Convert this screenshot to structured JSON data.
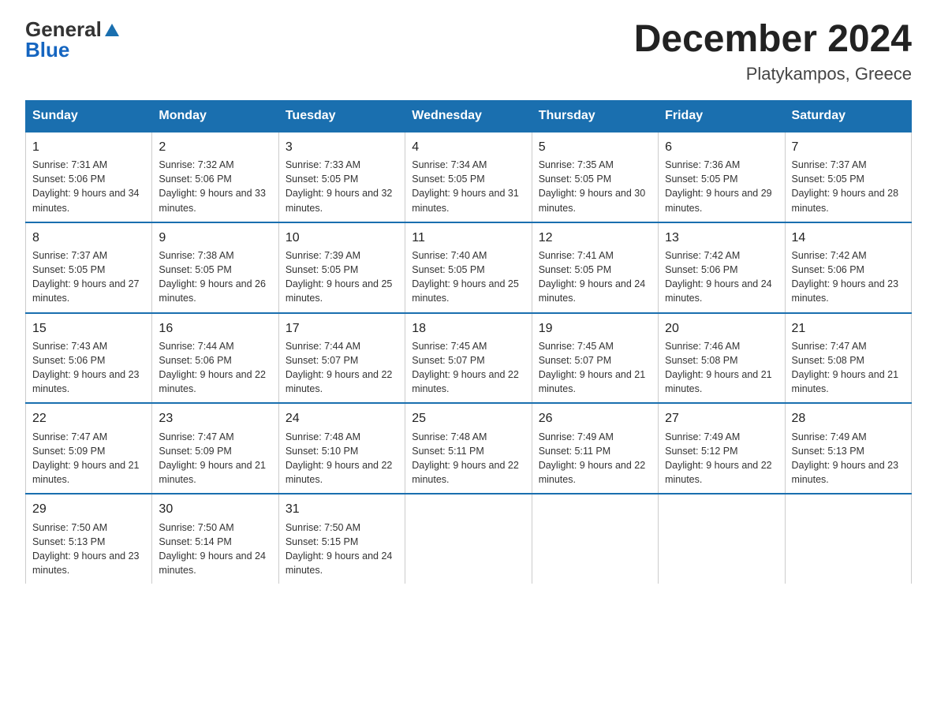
{
  "logo": {
    "general": "General",
    "blue": "Blue"
  },
  "header": {
    "month": "December 2024",
    "location": "Platykampos, Greece"
  },
  "days_of_week": [
    "Sunday",
    "Monday",
    "Tuesday",
    "Wednesday",
    "Thursday",
    "Friday",
    "Saturday"
  ],
  "weeks": [
    [
      {
        "day": "1",
        "sunrise": "Sunrise: 7:31 AM",
        "sunset": "Sunset: 5:06 PM",
        "daylight": "Daylight: 9 hours and 34 minutes."
      },
      {
        "day": "2",
        "sunrise": "Sunrise: 7:32 AM",
        "sunset": "Sunset: 5:06 PM",
        "daylight": "Daylight: 9 hours and 33 minutes."
      },
      {
        "day": "3",
        "sunrise": "Sunrise: 7:33 AM",
        "sunset": "Sunset: 5:05 PM",
        "daylight": "Daylight: 9 hours and 32 minutes."
      },
      {
        "day": "4",
        "sunrise": "Sunrise: 7:34 AM",
        "sunset": "Sunset: 5:05 PM",
        "daylight": "Daylight: 9 hours and 31 minutes."
      },
      {
        "day": "5",
        "sunrise": "Sunrise: 7:35 AM",
        "sunset": "Sunset: 5:05 PM",
        "daylight": "Daylight: 9 hours and 30 minutes."
      },
      {
        "day": "6",
        "sunrise": "Sunrise: 7:36 AM",
        "sunset": "Sunset: 5:05 PM",
        "daylight": "Daylight: 9 hours and 29 minutes."
      },
      {
        "day": "7",
        "sunrise": "Sunrise: 7:37 AM",
        "sunset": "Sunset: 5:05 PM",
        "daylight": "Daylight: 9 hours and 28 minutes."
      }
    ],
    [
      {
        "day": "8",
        "sunrise": "Sunrise: 7:37 AM",
        "sunset": "Sunset: 5:05 PM",
        "daylight": "Daylight: 9 hours and 27 minutes."
      },
      {
        "day": "9",
        "sunrise": "Sunrise: 7:38 AM",
        "sunset": "Sunset: 5:05 PM",
        "daylight": "Daylight: 9 hours and 26 minutes."
      },
      {
        "day": "10",
        "sunrise": "Sunrise: 7:39 AM",
        "sunset": "Sunset: 5:05 PM",
        "daylight": "Daylight: 9 hours and 25 minutes."
      },
      {
        "day": "11",
        "sunrise": "Sunrise: 7:40 AM",
        "sunset": "Sunset: 5:05 PM",
        "daylight": "Daylight: 9 hours and 25 minutes."
      },
      {
        "day": "12",
        "sunrise": "Sunrise: 7:41 AM",
        "sunset": "Sunset: 5:05 PM",
        "daylight": "Daylight: 9 hours and 24 minutes."
      },
      {
        "day": "13",
        "sunrise": "Sunrise: 7:42 AM",
        "sunset": "Sunset: 5:06 PM",
        "daylight": "Daylight: 9 hours and 24 minutes."
      },
      {
        "day": "14",
        "sunrise": "Sunrise: 7:42 AM",
        "sunset": "Sunset: 5:06 PM",
        "daylight": "Daylight: 9 hours and 23 minutes."
      }
    ],
    [
      {
        "day": "15",
        "sunrise": "Sunrise: 7:43 AM",
        "sunset": "Sunset: 5:06 PM",
        "daylight": "Daylight: 9 hours and 23 minutes."
      },
      {
        "day": "16",
        "sunrise": "Sunrise: 7:44 AM",
        "sunset": "Sunset: 5:06 PM",
        "daylight": "Daylight: 9 hours and 22 minutes."
      },
      {
        "day": "17",
        "sunrise": "Sunrise: 7:44 AM",
        "sunset": "Sunset: 5:07 PM",
        "daylight": "Daylight: 9 hours and 22 minutes."
      },
      {
        "day": "18",
        "sunrise": "Sunrise: 7:45 AM",
        "sunset": "Sunset: 5:07 PM",
        "daylight": "Daylight: 9 hours and 22 minutes."
      },
      {
        "day": "19",
        "sunrise": "Sunrise: 7:45 AM",
        "sunset": "Sunset: 5:07 PM",
        "daylight": "Daylight: 9 hours and 21 minutes."
      },
      {
        "day": "20",
        "sunrise": "Sunrise: 7:46 AM",
        "sunset": "Sunset: 5:08 PM",
        "daylight": "Daylight: 9 hours and 21 minutes."
      },
      {
        "day": "21",
        "sunrise": "Sunrise: 7:47 AM",
        "sunset": "Sunset: 5:08 PM",
        "daylight": "Daylight: 9 hours and 21 minutes."
      }
    ],
    [
      {
        "day": "22",
        "sunrise": "Sunrise: 7:47 AM",
        "sunset": "Sunset: 5:09 PM",
        "daylight": "Daylight: 9 hours and 21 minutes."
      },
      {
        "day": "23",
        "sunrise": "Sunrise: 7:47 AM",
        "sunset": "Sunset: 5:09 PM",
        "daylight": "Daylight: 9 hours and 21 minutes."
      },
      {
        "day": "24",
        "sunrise": "Sunrise: 7:48 AM",
        "sunset": "Sunset: 5:10 PM",
        "daylight": "Daylight: 9 hours and 22 minutes."
      },
      {
        "day": "25",
        "sunrise": "Sunrise: 7:48 AM",
        "sunset": "Sunset: 5:11 PM",
        "daylight": "Daylight: 9 hours and 22 minutes."
      },
      {
        "day": "26",
        "sunrise": "Sunrise: 7:49 AM",
        "sunset": "Sunset: 5:11 PM",
        "daylight": "Daylight: 9 hours and 22 minutes."
      },
      {
        "day": "27",
        "sunrise": "Sunrise: 7:49 AM",
        "sunset": "Sunset: 5:12 PM",
        "daylight": "Daylight: 9 hours and 22 minutes."
      },
      {
        "day": "28",
        "sunrise": "Sunrise: 7:49 AM",
        "sunset": "Sunset: 5:13 PM",
        "daylight": "Daylight: 9 hours and 23 minutes."
      }
    ],
    [
      {
        "day": "29",
        "sunrise": "Sunrise: 7:50 AM",
        "sunset": "Sunset: 5:13 PM",
        "daylight": "Daylight: 9 hours and 23 minutes."
      },
      {
        "day": "30",
        "sunrise": "Sunrise: 7:50 AM",
        "sunset": "Sunset: 5:14 PM",
        "daylight": "Daylight: 9 hours and 24 minutes."
      },
      {
        "day": "31",
        "sunrise": "Sunrise: 7:50 AM",
        "sunset": "Sunset: 5:15 PM",
        "daylight": "Daylight: 9 hours and 24 minutes."
      },
      {
        "day": "",
        "sunrise": "",
        "sunset": "",
        "daylight": ""
      },
      {
        "day": "",
        "sunrise": "",
        "sunset": "",
        "daylight": ""
      },
      {
        "day": "",
        "sunrise": "",
        "sunset": "",
        "daylight": ""
      },
      {
        "day": "",
        "sunrise": "",
        "sunset": "",
        "daylight": ""
      }
    ]
  ]
}
